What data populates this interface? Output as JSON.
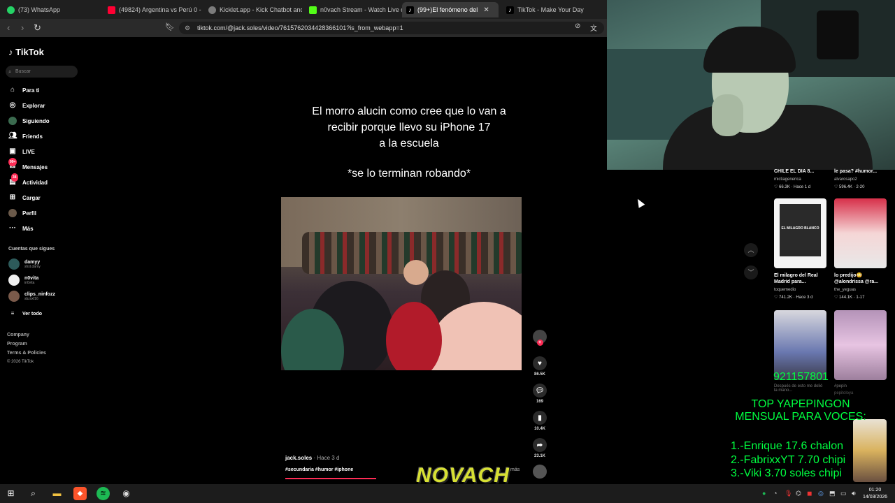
{
  "tabs": [
    {
      "label": "(73) WhatsApp",
      "color": "#25d366"
    },
    {
      "label": "(49824) Argentina vs Perú 0 - 0",
      "color": "#ff0033"
    },
    {
      "label": "Kicklet.app - Kick Chatbot and",
      "color": "#7c7c7c"
    },
    {
      "label": "n0vach Stream - Watch Live on",
      "color": "#53fc18"
    },
    {
      "label": "(99+)El fenómeno del",
      "color": "#ffffff"
    },
    {
      "label": "TikTok - Make Your Day",
      "color": "#ffffff"
    }
  ],
  "address": {
    "url": "tiktok.com/@jack.soles/video/7615762034428366101?is_from_webapp=1"
  },
  "sidebar": {
    "logo": "TikTok",
    "search_placeholder": "Buscar",
    "items": [
      {
        "label": "Para ti",
        "icon": "home-icon"
      },
      {
        "label": "Explorar",
        "icon": "compass-icon"
      },
      {
        "label": "Siguiendo",
        "icon": "following-icon"
      },
      {
        "label": "Friends",
        "icon": "friends-icon"
      },
      {
        "label": "LIVE",
        "icon": "live-icon"
      },
      {
        "label": "Mensajes",
        "icon": "message-icon",
        "badge": "99+"
      },
      {
        "label": "Actividad",
        "icon": "activity-icon",
        "badge": "34"
      },
      {
        "label": "Cargar",
        "icon": "upload-icon"
      },
      {
        "label": "Perfil",
        "icon": "profile-icon"
      },
      {
        "label": "Más",
        "icon": "more-icon"
      }
    ],
    "following_title": "Cuentas que sigues",
    "following": [
      {
        "name": "damyy",
        "handle": "shxt.damy"
      },
      {
        "name": "n0vita",
        "handle": "in0vita"
      },
      {
        "name": "clips_ninfozz",
        "handle": "sbzxxf16"
      }
    ],
    "see_all": "Ver todo",
    "footer": [
      "Company",
      "Program",
      "Terms & Policies",
      "© 2026 TikTok"
    ]
  },
  "video": {
    "caption_lines": [
      "El morro alucin como cree que lo van a",
      "recibir porque llevo su iPhone 17",
      "a la escuela"
    ],
    "caption_extra": "*se lo terminan robando*",
    "author": "jack.soles",
    "posted": "· Hace 3 d",
    "tags": "#secundaria #humor #iphone",
    "more": "más",
    "likes": "86.5K",
    "comments": "169",
    "saves": "10.4K",
    "shares": "23.1K"
  },
  "right_column": {
    "row0": [
      {
        "title": "CHILE EL DIA 8...",
        "user": "mictiagenerica",
        "meta": "♡ 66.3K · Hace 1 d"
      },
      {
        "title": "le pasa? #humor...",
        "user": "alvarosapo2",
        "meta": "♡ 596.4K · 2-20"
      }
    ],
    "row1": [
      {
        "title": "El milagro del Real Madrid para...",
        "user": "toquemedio",
        "meta": "♡ 741.2K · Hace 3 d",
        "thumb_text": "EL MILAGRO BLANCO"
      },
      {
        "title": "lo predijo😳 @alondrissa @ra...",
        "user": "the_yeguas",
        "meta": "♡ 144.1K · 1-17"
      }
    ],
    "row2": [
      {
        "title": "Después de esto me dolió la mano...",
        "user": "",
        "meta": ""
      },
      {
        "title": "#pepin",
        "user": "pepitoloya",
        "meta": "♡ ... · 2-2"
      }
    ]
  },
  "overlay": {
    "phone": "921157801",
    "title_line1": "TOP YAPEPINGON",
    "title_line2": "MENSUAL PARA VOCES:",
    "ranks": [
      "1.-Enrique 17.6 chalon",
      "2.-FabrixxYT 7.70 chipi",
      "3.-Viki 3.70 soles chipi"
    ],
    "logo_text": "NOVACH"
  },
  "taskbar": {
    "time": "01:20",
    "date": "14/03/2026"
  }
}
